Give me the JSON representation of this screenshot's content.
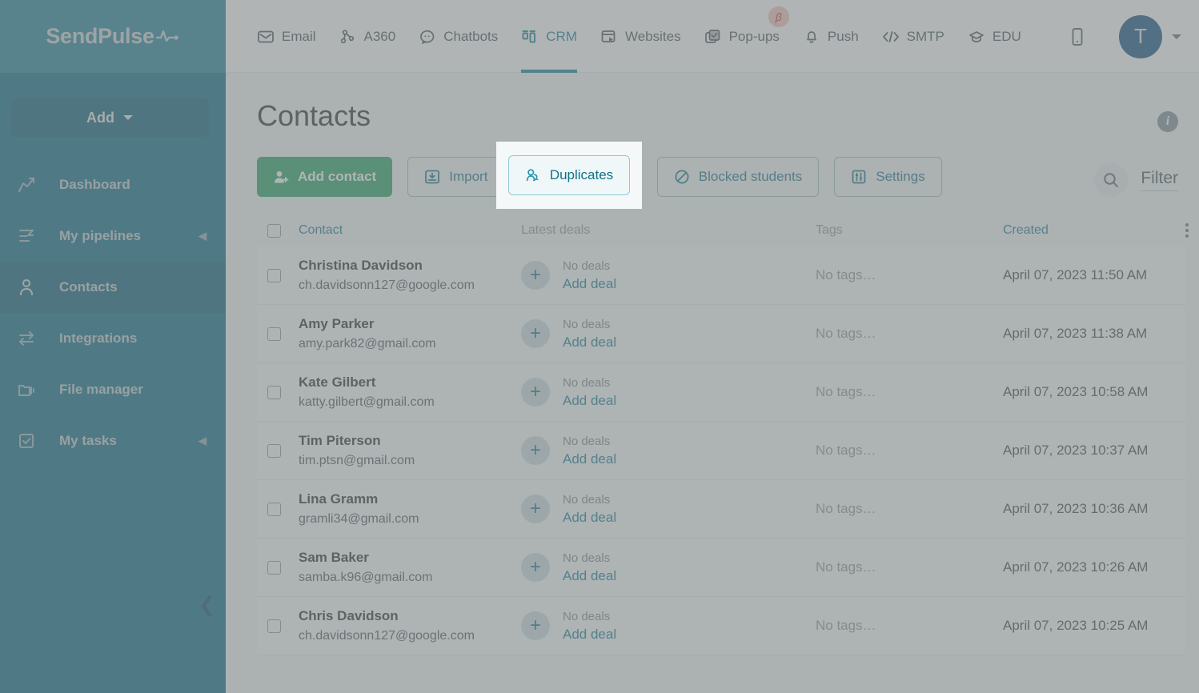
{
  "brand": {
    "name": "SendPulse",
    "logo_icon": "pulse-wave-icon",
    "sidebar_bg": "#006680",
    "logo_bg": "#1a7e96",
    "accent": "#0a7b94",
    "primary_button": "#1e9e5f"
  },
  "sidebar": {
    "add_button": {
      "label": "Add",
      "icon": "chevron-down-icon"
    },
    "items": [
      {
        "label": "Dashboard",
        "icon": "chart-line-icon",
        "active": false,
        "has_arrow": false
      },
      {
        "label": "My pipelines",
        "icon": "pipeline-icon",
        "active": false,
        "has_arrow": true
      },
      {
        "label": "Contacts",
        "icon": "contacts-icon",
        "active": true,
        "has_arrow": false
      },
      {
        "label": "Integrations",
        "icon": "exchange-icon",
        "active": false,
        "has_arrow": false
      },
      {
        "label": "File manager",
        "icon": "folder-icon",
        "active": false,
        "has_arrow": false
      },
      {
        "label": "My tasks",
        "icon": "checkbox-icon",
        "active": false,
        "has_arrow": true
      }
    ],
    "collapse_icon": "chevron-left-icon"
  },
  "header": {
    "tabs": [
      {
        "label": "Email",
        "icon": "envelope-icon",
        "active": false,
        "badge": null
      },
      {
        "label": "A360",
        "icon": "nodes-icon",
        "active": false,
        "badge": null
      },
      {
        "label": "Chatbots",
        "icon": "chat-icon",
        "active": false,
        "badge": null
      },
      {
        "label": "CRM",
        "icon": "crm-board-icon",
        "active": true,
        "badge": null
      },
      {
        "label": "Websites",
        "icon": "website-icon",
        "active": false,
        "badge": null
      },
      {
        "label": "Pop-ups",
        "icon": "popup-icon",
        "active": false,
        "badge": "β"
      },
      {
        "label": "Push",
        "icon": "bell-icon",
        "active": false,
        "badge": null
      },
      {
        "label": "SMTP",
        "icon": "code-icon",
        "active": false,
        "badge": null
      },
      {
        "label": "EDU",
        "icon": "graduation-cap-icon",
        "active": false,
        "badge": null
      }
    ],
    "mobile_icon": "mobile-phone-icon",
    "avatar_initial": "T",
    "avatar_color": "#0c4b7e",
    "avatar_caret_icon": "chevron-down-icon"
  },
  "page": {
    "title": "Contacts",
    "info_icon": "info-icon"
  },
  "toolbar": {
    "buttons": [
      {
        "label": "Add contact",
        "icon": "add-user-icon",
        "style": "primary",
        "highlighted": false
      },
      {
        "label": "Import",
        "icon": "import-icon",
        "style": "secondary",
        "highlighted": false
      },
      {
        "label": "Duplicates",
        "icon": "duplicates-icon",
        "style": "secondary",
        "highlighted": true
      },
      {
        "label": "Blocked students",
        "icon": "blocked-icon",
        "style": "secondary",
        "highlighted": false
      },
      {
        "label": "Settings",
        "icon": "sliders-icon",
        "style": "secondary",
        "highlighted": false
      }
    ]
  },
  "search": {
    "icon": "search-icon",
    "filter_label": "Filter"
  },
  "table": {
    "columns": [
      {
        "label": "Contact",
        "is_link": true
      },
      {
        "label": "Latest deals",
        "is_link": false
      },
      {
        "label": "Tags",
        "is_link": false
      },
      {
        "label": "Created",
        "is_link": true
      }
    ],
    "header_menu_icon": "kebab-menu-icon",
    "rows": [
      {
        "name": "Christina Davidson",
        "email": "ch.davidsonn127@google.com",
        "deals": "No deals",
        "add_deal": "Add deal",
        "tags": "No tags…",
        "created": "April 07, 2023 11:50 AM"
      },
      {
        "name": "Amy Parker",
        "email": "amy.park82@gmail.com",
        "deals": "No deals",
        "add_deal": "Add deal",
        "tags": "No tags…",
        "created": "April 07, 2023 11:38 AM"
      },
      {
        "name": "Kate Gilbert",
        "email": "katty.gilbert@gmail.com",
        "deals": "No deals",
        "add_deal": "Add deal",
        "tags": "No tags…",
        "created": "April 07, 2023 10:58 AM"
      },
      {
        "name": "Tim Piterson",
        "email": "tim.ptsn@gmail.com",
        "deals": "No deals",
        "add_deal": "Add deal",
        "tags": "No tags…",
        "created": "April 07, 2023 10:37 AM"
      },
      {
        "name": "Lina Gramm",
        "email": "gramli34@gmail.com",
        "deals": "No deals",
        "add_deal": "Add deal",
        "tags": "No tags…",
        "created": "April 07, 2023 10:36 AM"
      },
      {
        "name": "Sam Baker",
        "email": "samba.k96@gmail.com",
        "deals": "No deals",
        "add_deal": "Add deal",
        "tags": "No tags…",
        "created": "April 07, 2023 10:26 AM"
      },
      {
        "name": "Chris Davidson",
        "email": "ch.davidsonn127@google.com",
        "deals": "No deals",
        "add_deal": "Add deal",
        "tags": "No tags…",
        "created": "April 07, 2023 10:25 AM"
      }
    ]
  }
}
